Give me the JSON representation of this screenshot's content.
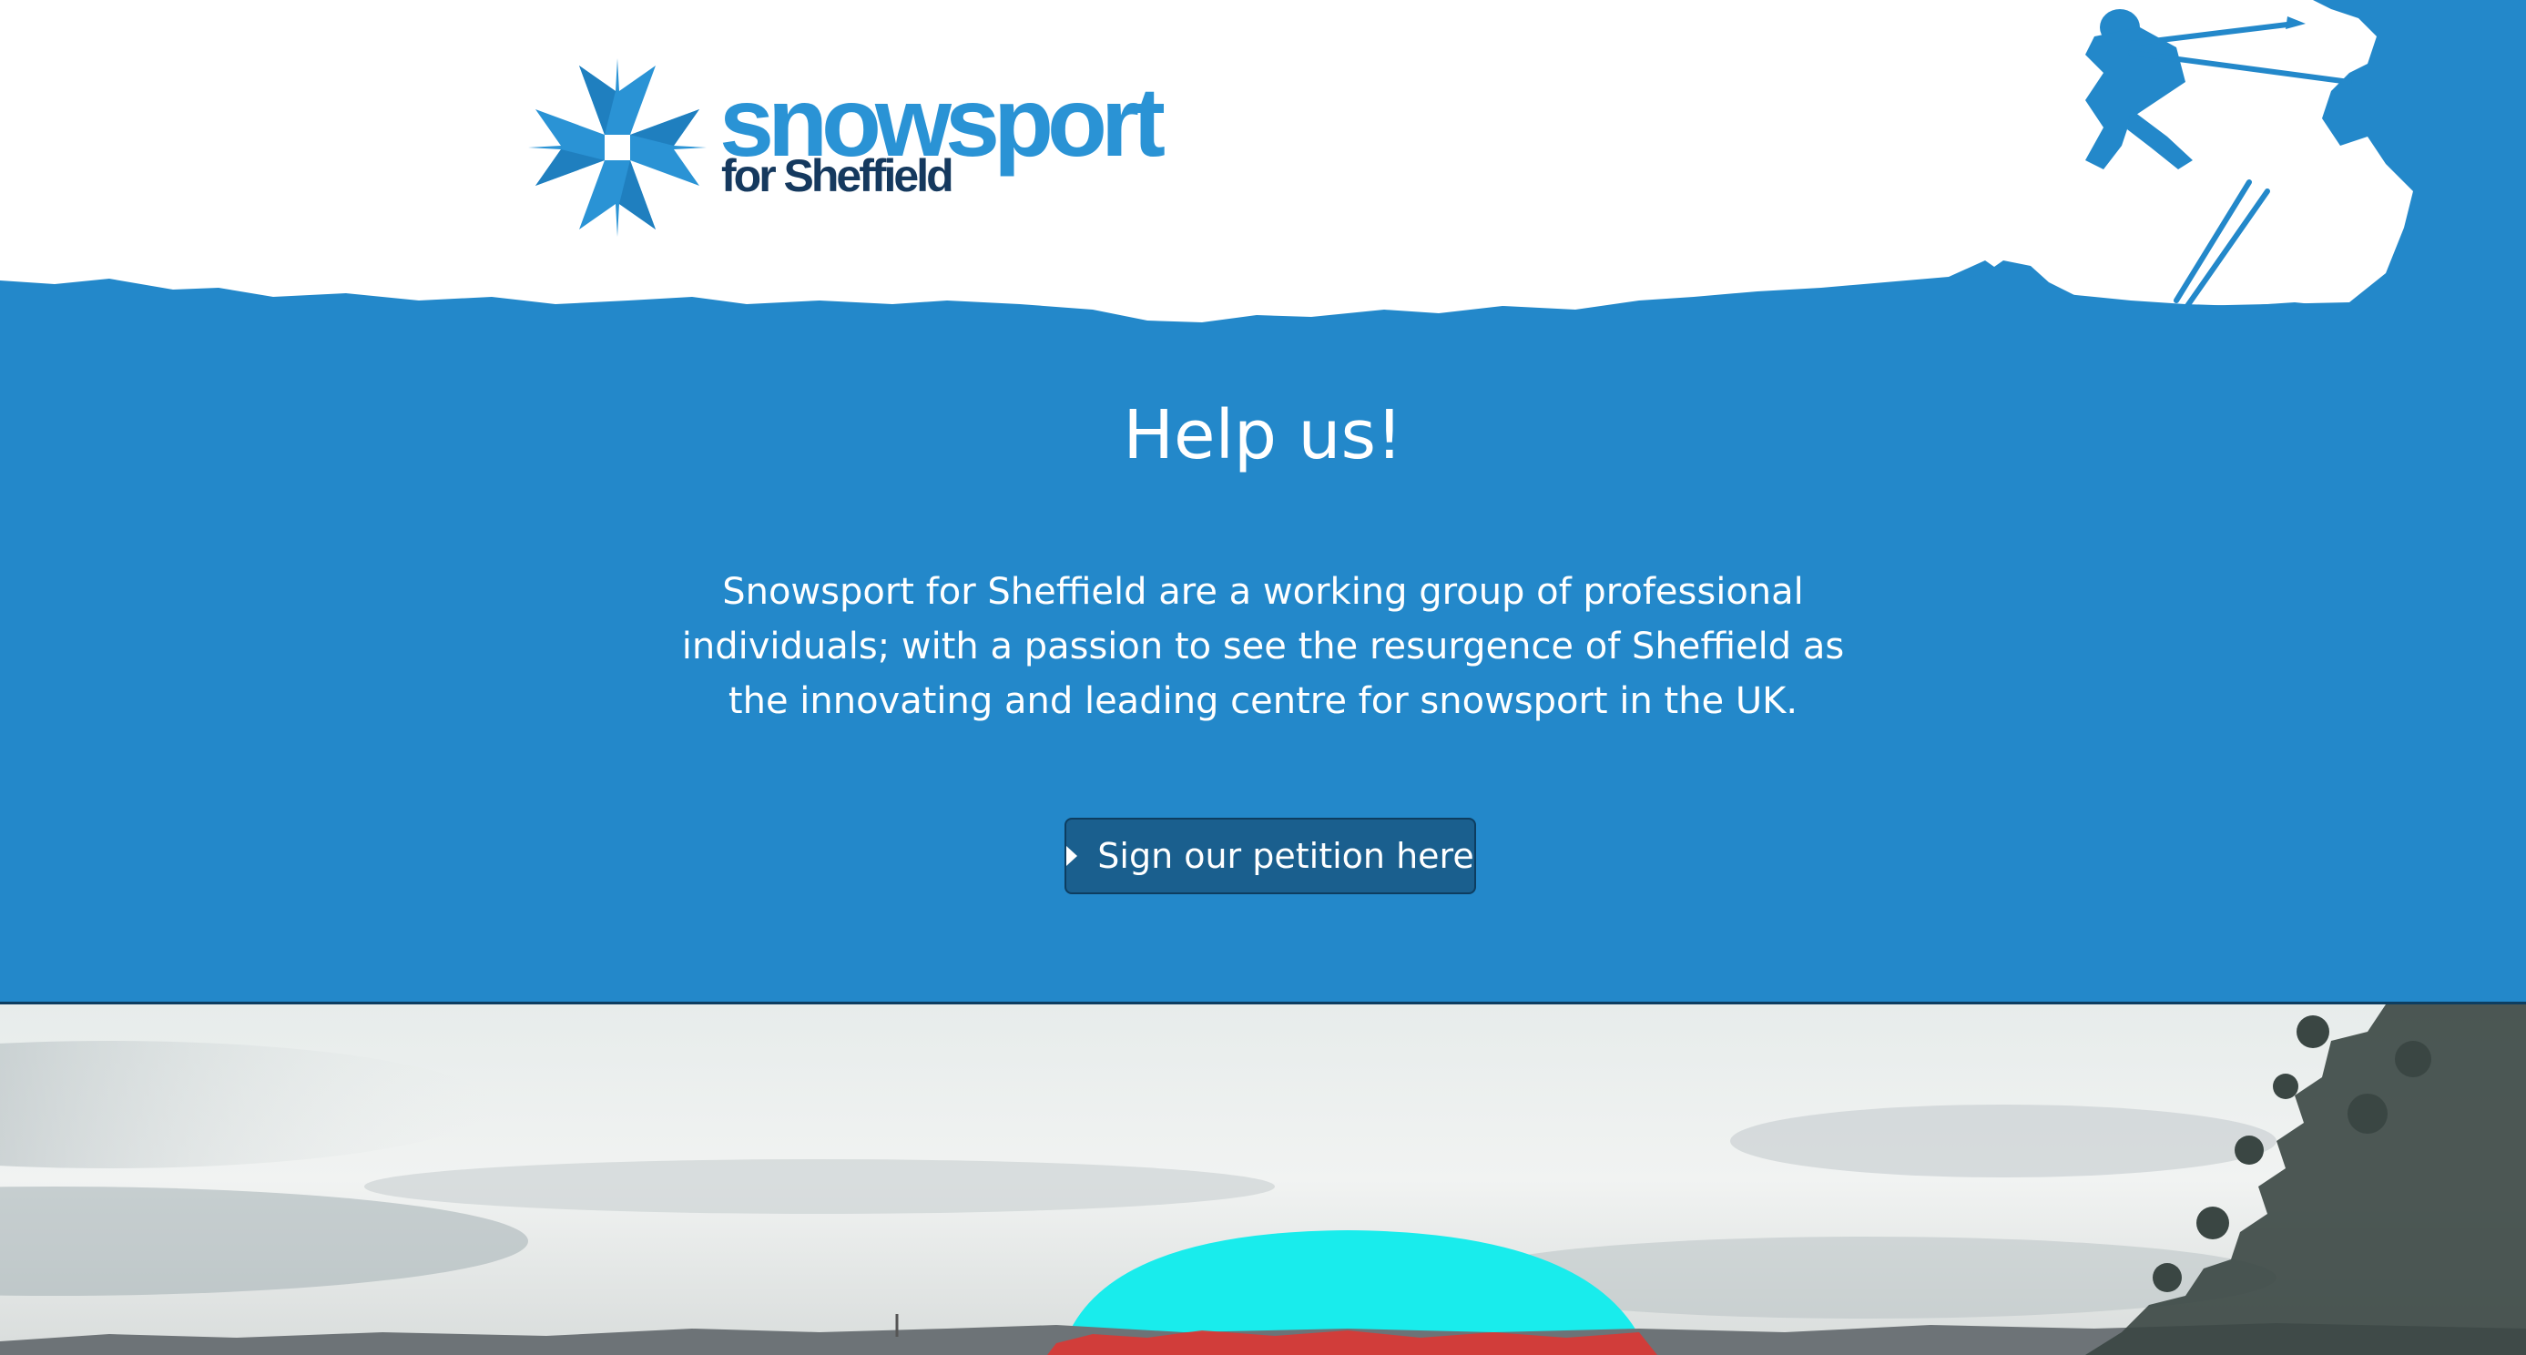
{
  "header": {
    "logo_wordmark": "snowsport",
    "logo_subtitle": "for Sheffield",
    "logo_icon": "snowflake-cross-logo",
    "skier_icon": "skier-silhouette"
  },
  "help": {
    "heading": "Help us!",
    "paragraph": "Snowsport for Sheffield are a working group of professional individuals; with a passion to see the resurgence of Sheffield as the innovating and leading centre for snowsport in the UK.",
    "button_label": "Sign our petition here",
    "button_icon": "caret-right-icon"
  },
  "hero": {
    "image": "sheffield-skyline-with-dome-photo"
  },
  "colors": {
    "brand_blue": "#2388ca",
    "logo_blue": "#2a93d5",
    "navy": "#15395e",
    "button_bg": "#1a5f8e",
    "dome_cyan": "#19ecec"
  }
}
